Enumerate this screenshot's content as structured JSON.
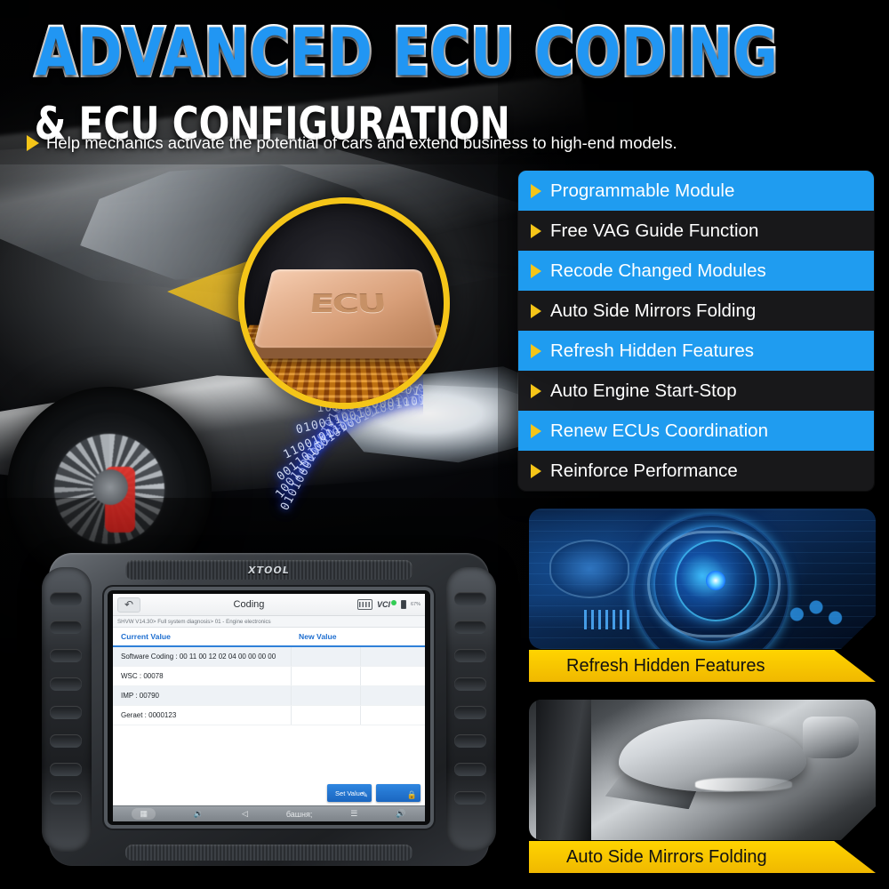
{
  "banner": {
    "headline_line1": "ADVANCED ECU CODING",
    "headline_line2": "& ECU CONFIGURATION",
    "tagline": "Help mechanics activate the potential of cars and extend business to high-end models.",
    "accent_blue": "#2196f3",
    "accent_yellow": "#f5c518",
    "list_highlight_blue": "#1f9cf0"
  },
  "chip": {
    "label": "ECU",
    "binary_streams": [
      "0101000110010100011001010001100101000110",
      "1001100001011001100001011001100001011001",
      "0011010010100110100101001101001010011010",
      "1100101100011001011000110010110001100101",
      "0100110010100101001100101001010011001010",
      "1010011000110100110001101001100011010011",
      "0110100101100110100101100110100101100110"
    ]
  },
  "features": [
    {
      "label": "Programmable Module",
      "style": "hl"
    },
    {
      "label": "Free VAG Guide Function",
      "style": "dk"
    },
    {
      "label": "Recode Changed Modules",
      "style": "hl"
    },
    {
      "label": "Auto Side Mirrors Folding",
      "style": "dk"
    },
    {
      "label": "Refresh Hidden Features",
      "style": "hl"
    },
    {
      "label": "Auto Engine Start-Stop",
      "style": "dk"
    },
    {
      "label": "Renew ECUs Coordination",
      "style": "hl"
    },
    {
      "label": "Reinforce Performance",
      "style": "dk"
    }
  ],
  "tablet": {
    "brand": "XTOOL",
    "screen": {
      "back_icon": "back-arrow-icon",
      "title": "Coding",
      "keyboard_icon": "keyboard-icon",
      "vci_label": "VCI",
      "battery_pct": "67%",
      "breadcrumb": "SHVW V14.30> Full system diagnosis> 01 - Engine electronics",
      "columns": [
        "Current Value",
        "New Value",
        ""
      ],
      "rows": [
        {
          "current": "Software Coding : 00 11 00 12 02 04 00 00 00 00",
          "new": "",
          "extra": ""
        },
        {
          "current": "WSC : 00078",
          "new": "",
          "extra": ""
        },
        {
          "current": "IMP : 00790",
          "new": "",
          "extra": ""
        },
        {
          "current": "Geraet : 0000123",
          "new": "",
          "extra": ""
        }
      ],
      "buttons": [
        {
          "label": "Set Value",
          "icon": "edit-icon"
        },
        {
          "label": "",
          "icon": "lock-icon"
        }
      ],
      "navbar": [
        "screenshot-icon",
        "volume-down-icon",
        "back-icon",
        "home-icon",
        "menu-icon",
        "volume-up-icon"
      ]
    }
  },
  "photo_cards": [
    {
      "caption": "Refresh Hidden Features",
      "art": "car-dashboard"
    },
    {
      "caption": "Auto Side Mirrors Folding",
      "art": "side-mirror"
    }
  ]
}
